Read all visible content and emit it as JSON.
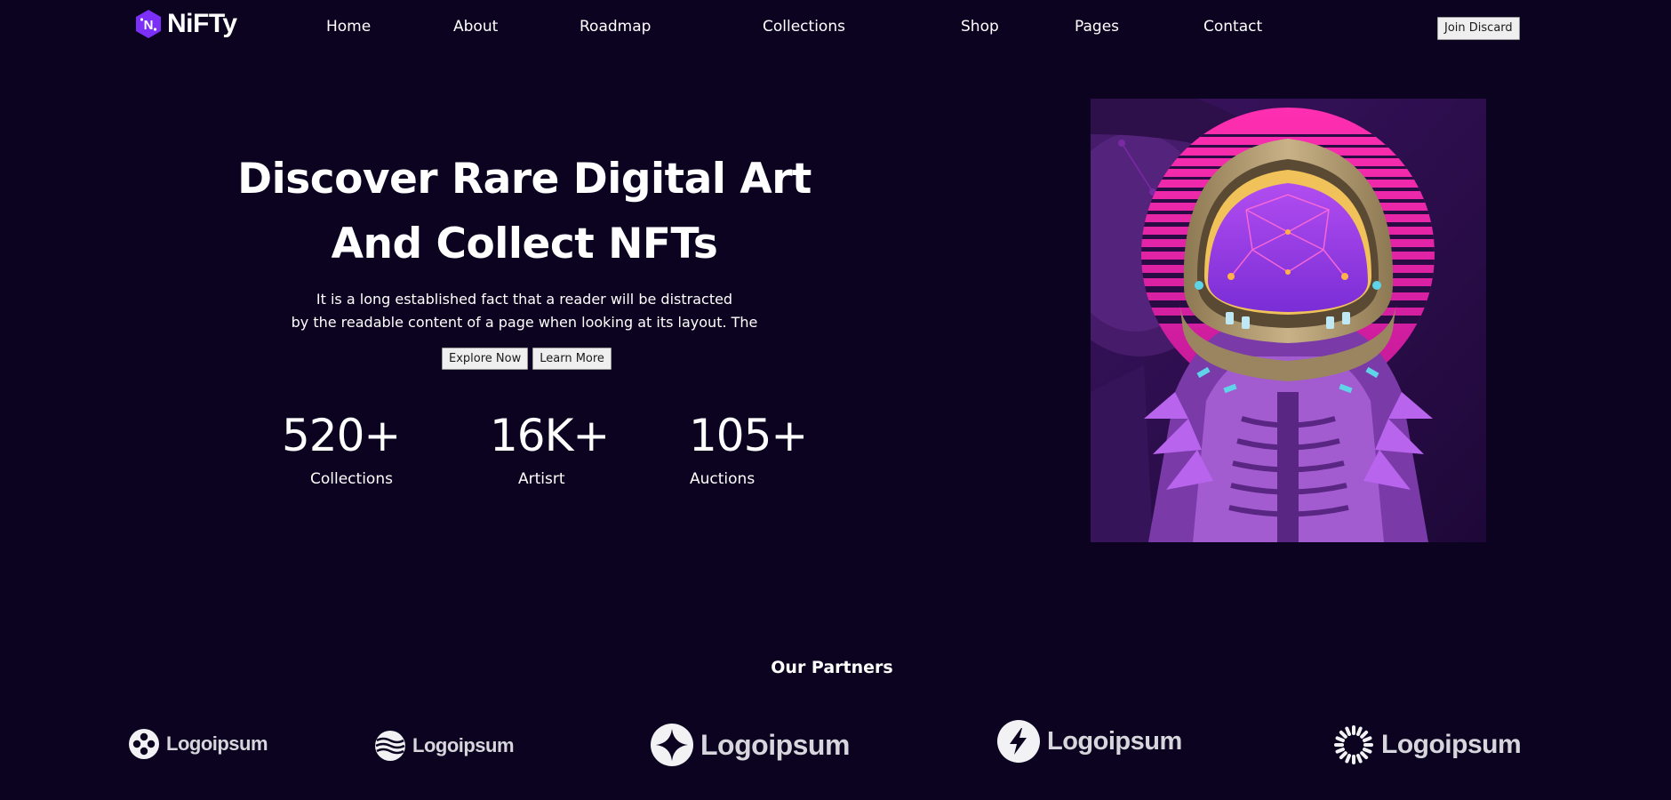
{
  "header": {
    "brand_name": "NiFTy",
    "brand_logo_letter": "N",
    "nav": [
      {
        "label": "Home"
      },
      {
        "label": "About"
      },
      {
        "label": "Roadmap"
      },
      {
        "label": "Collections"
      },
      {
        "label": "Shop"
      },
      {
        "label": "Pages"
      },
      {
        "label": "Contact"
      }
    ],
    "join_label": "Join Discard"
  },
  "hero": {
    "title_line1": "Discover Rare Digital Art",
    "title_line2": "And Collect NFTs",
    "desc_line1": "It is a long established fact that a reader will be distracted",
    "desc_line2": "by the readable content of a page when looking at its layout. The",
    "explore_label": "Explore Now",
    "learn_label": "Learn More",
    "stats": [
      {
        "value": "520+",
        "label": "Collections"
      },
      {
        "value": "16K+",
        "label": "Artisrt"
      },
      {
        "value": "105+",
        "label": "Auctions"
      }
    ]
  },
  "partners": {
    "title": "Our Partners",
    "items": [
      {
        "name": "Logoipsum",
        "icon": "dots-circle-icon"
      },
      {
        "name": "Logoipsum",
        "icon": "waves-circle-icon"
      },
      {
        "name": "Logoipsum",
        "icon": "sparkle-circle-icon"
      },
      {
        "name": "Logoipsum",
        "icon": "bolt-circle-icon"
      },
      {
        "name": "Logoipsum",
        "icon": "sunburst-icon"
      }
    ]
  },
  "colors": {
    "background": "#0b0320",
    "brand_purple": "#7b2ff7",
    "text": "#ffffff",
    "partner_gray": "#d6d6dc"
  }
}
